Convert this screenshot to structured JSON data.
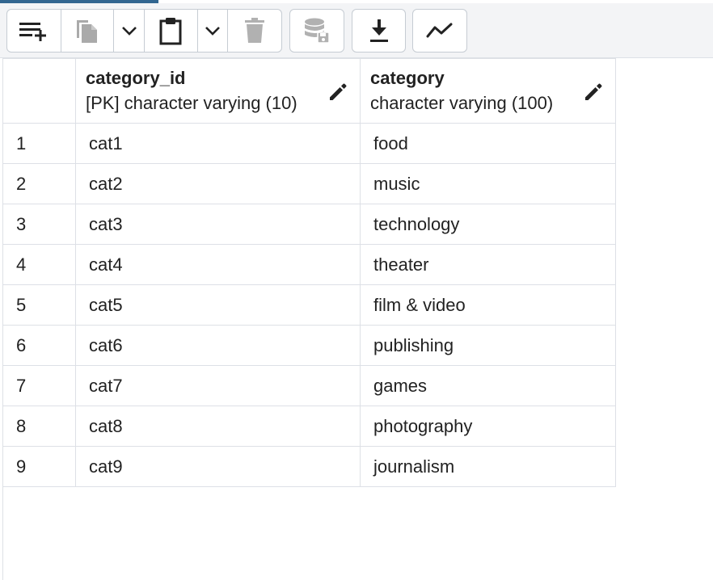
{
  "toolbar": {
    "buttons": [
      {
        "icon": "add-row-icon",
        "label": "Add row"
      },
      {
        "icon": "copy-icon",
        "label": "Copy"
      },
      {
        "icon": "chevron-down-icon",
        "label": "Copy options"
      },
      {
        "icon": "paste-icon",
        "label": "Paste"
      },
      {
        "icon": "chevron-down-icon",
        "label": "Paste options"
      },
      {
        "icon": "delete-icon",
        "label": "Delete"
      },
      {
        "icon": "save-data-icon",
        "label": "Save data changes"
      },
      {
        "icon": "download-icon",
        "label": "Save results to file"
      },
      {
        "icon": "graph-icon",
        "label": "Graph visualiser"
      }
    ]
  },
  "grid": {
    "columns": [
      {
        "name": "category_id",
        "type": "[PK] character varying (10)"
      },
      {
        "name": "category",
        "type": "character varying (100)"
      }
    ],
    "rows": [
      {
        "num": "1",
        "category_id": "cat1",
        "category": "food"
      },
      {
        "num": "2",
        "category_id": "cat2",
        "category": "music"
      },
      {
        "num": "3",
        "category_id": "cat3",
        "category": "technology"
      },
      {
        "num": "4",
        "category_id": "cat4",
        "category": "theater"
      },
      {
        "num": "5",
        "category_id": "cat5",
        "category": "film & video"
      },
      {
        "num": "6",
        "category_id": "cat6",
        "category": "publishing"
      },
      {
        "num": "7",
        "category_id": "cat7",
        "category": "games"
      },
      {
        "num": "8",
        "category_id": "cat8",
        "category": "photography"
      },
      {
        "num": "9",
        "category_id": "cat9",
        "category": "journalism"
      }
    ]
  },
  "colors": {
    "accent": "#326690",
    "toolbar_bg": "#f3f4f6",
    "border": "#dde0e6",
    "icon": "#222222"
  }
}
